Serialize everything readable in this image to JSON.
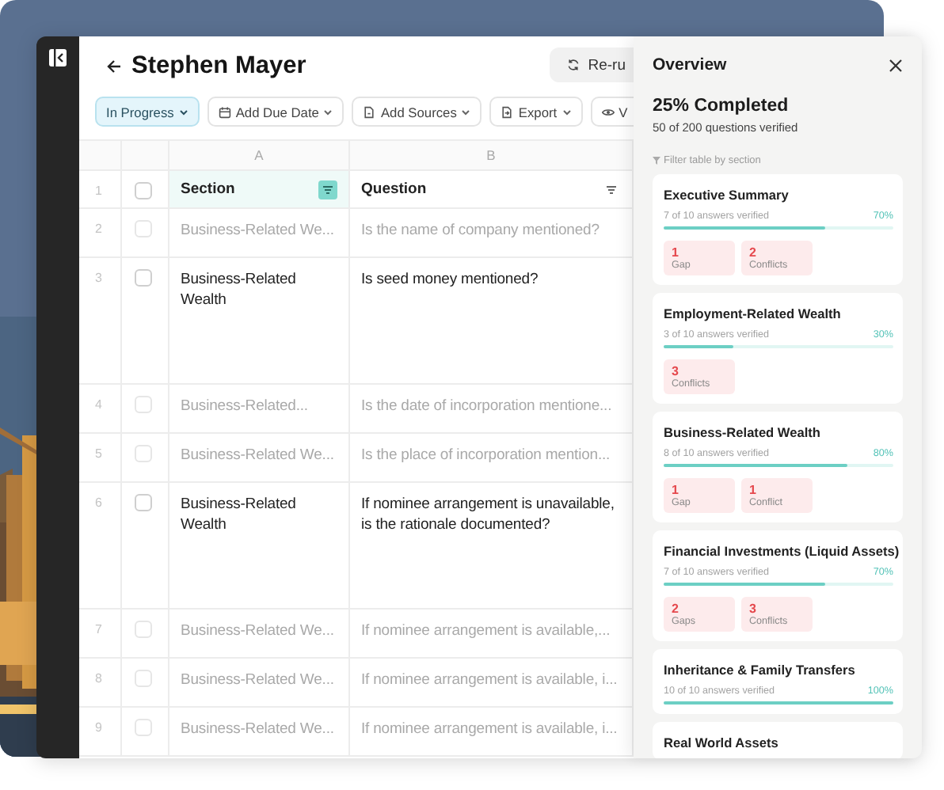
{
  "header": {
    "title": "Stephen Mayer",
    "rerun_label": "Re-ru"
  },
  "toolbar": [
    {
      "label": "In Progress",
      "kind": "status",
      "selected": true
    },
    {
      "label": "Add Due Date",
      "kind": "date",
      "selected": false
    },
    {
      "label": "Add Sources",
      "kind": "sources",
      "selected": false
    },
    {
      "label": "Export",
      "kind": "export",
      "selected": false
    },
    {
      "label": "V",
      "kind": "view",
      "selected": false
    }
  ],
  "table": {
    "columns": [
      {
        "letter": "A",
        "title": "Section",
        "filtered": true
      },
      {
        "letter": "B",
        "title": "Question",
        "filtered": false
      }
    ],
    "header_row": "1",
    "all_checked": false,
    "rows": [
      {
        "number": "2",
        "section": "Business-Related We...",
        "question": "Is the name of company mentioned?",
        "dimmed": true,
        "expanded": false,
        "checked": false
      },
      {
        "number": "3",
        "section": "Business-Related Wealth",
        "question": "Is seed money mentioned?",
        "dimmed": false,
        "expanded": true,
        "checked": false
      },
      {
        "number": "4",
        "section": "Business-Related...",
        "question": "Is the date of incorporation mentione...",
        "dimmed": true,
        "expanded": false,
        "checked": false
      },
      {
        "number": "5",
        "section": "Business-Related We...",
        "question": "Is the place of incorporation mention...",
        "dimmed": true,
        "expanded": false,
        "checked": false
      },
      {
        "number": "6",
        "section": "Business-Related Wealth",
        "question": "If nominee arrangement is unavailable, is the rationale documented?",
        "dimmed": false,
        "expanded": true,
        "checked": false
      },
      {
        "number": "7",
        "section": "Business-Related We...",
        "question": "If nominee arrangement is available,...",
        "dimmed": true,
        "expanded": false,
        "checked": false
      },
      {
        "number": "8",
        "section": "Business-Related We...",
        "question": "If nominee arrangement is available, i...",
        "dimmed": true,
        "expanded": false,
        "checked": false
      },
      {
        "number": "9",
        "section": "Business-Related We...",
        "question": "If nominee arrangement is available, i...",
        "dimmed": true,
        "expanded": false,
        "checked": false
      }
    ]
  },
  "overview": {
    "title": "Overview",
    "completed": "25% Completed",
    "summary": "50 of 200 questions verified",
    "filter_label": "Filter table by section",
    "sections": [
      {
        "title": "Executive Summary",
        "verified": "7 of 10 answers verified",
        "percent": "70%",
        "level": 0.7,
        "issues": [
          {
            "count": "1",
            "label": "Gap"
          },
          {
            "count": "2",
            "label": "Conflicts"
          }
        ]
      },
      {
        "title": "Employment-Related Wealth",
        "verified": "3 of 10 answers verified",
        "percent": "30%",
        "level": 0.3,
        "issues": [
          {
            "count": "3",
            "label": "Conflicts"
          }
        ]
      },
      {
        "title": "Business-Related Wealth",
        "verified": "8 of 10 answers verified",
        "percent": "80%",
        "level": 0.8,
        "issues": [
          {
            "count": "1",
            "label": "Gap"
          },
          {
            "count": "1",
            "label": "Conflict"
          }
        ]
      },
      {
        "title": "Financial Investments (Liquid Assets)",
        "verified": "7 of 10 answers verified",
        "percent": "70%",
        "level": 0.7,
        "issues": [
          {
            "count": "2",
            "label": "Gaps"
          },
          {
            "count": "3",
            "label": "Conflicts"
          }
        ]
      },
      {
        "title": "Inheritance & Family Transfers",
        "verified": "10 of 10 answers verified",
        "percent": "100%",
        "level": 1
      },
      {
        "title": "Real World Assets"
      }
    ]
  }
}
